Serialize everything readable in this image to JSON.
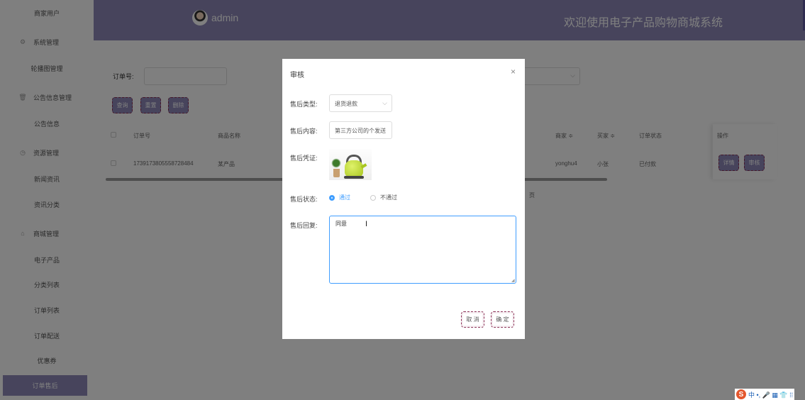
{
  "sidebar": {
    "items": [
      {
        "label": "商家用户",
        "icon": ""
      },
      {
        "label": "系统管理",
        "icon": "gear-icon"
      },
      {
        "label": "轮播图管理",
        "icon": ""
      },
      {
        "label": "公告信息管理",
        "icon": "trash-icon"
      },
      {
        "label": "公告信息",
        "icon": ""
      },
      {
        "label": "资源管理",
        "icon": "clock-icon"
      },
      {
        "label": "新闻资讯",
        "icon": ""
      },
      {
        "label": "资讯分类",
        "icon": ""
      },
      {
        "label": "商城管理",
        "icon": "home-icon"
      },
      {
        "label": "电子产品",
        "icon": ""
      },
      {
        "label": "分类列表",
        "icon": ""
      },
      {
        "label": "订单列表",
        "icon": ""
      },
      {
        "label": "订单配送",
        "icon": ""
      },
      {
        "label": "优惠券",
        "icon": ""
      },
      {
        "label": "订单售后",
        "icon": ""
      }
    ],
    "active_index": 14
  },
  "header": {
    "username": "admin",
    "welcome": "欢迎使用电子产品购物商城系统"
  },
  "filters": {
    "order_no_label": "订单号:",
    "order_no_value": ""
  },
  "toolbar": {
    "query_label": "查询",
    "reset_label": "重置",
    "delete_label": "删除"
  },
  "table": {
    "headers": {
      "order_no": "订单号",
      "product_name": "商品名称",
      "merchant": "商家 ≑",
      "buyer": "买家 ≑",
      "status": "订单状态",
      "actions": "操作"
    },
    "rows": [
      {
        "order_no": "1739173805558728484",
        "product_name": "某产品",
        "merchant": "yonghu4",
        "buyer": "小张",
        "status": "已付款",
        "detail_label": "详情",
        "review_label": "审核"
      }
    ]
  },
  "pagination": {
    "text": "页"
  },
  "dialog": {
    "title": "审核",
    "close_glyph": "×",
    "fields": {
      "type_label": "售后类型:",
      "type_value": "退货退款",
      "content_label": "售后内容:",
      "content_value": "第三方公司的个发送",
      "proof_label": "售后凭证:",
      "status_label": "售后状态:",
      "status_options": [
        "通过",
        "不通过"
      ],
      "status_selected": 0,
      "reply_label": "售后回复:",
      "reply_value": "同意"
    },
    "cancel_label": "取 消",
    "confirm_label": "确 定"
  },
  "ime": {
    "logo": "S",
    "text": "中 •, 🎤 ▦ 👕 ⁞⁞"
  },
  "colors": {
    "primary": "#8e89b8",
    "accent_blue": "#409eff",
    "dash_border": "#8a2f55"
  }
}
